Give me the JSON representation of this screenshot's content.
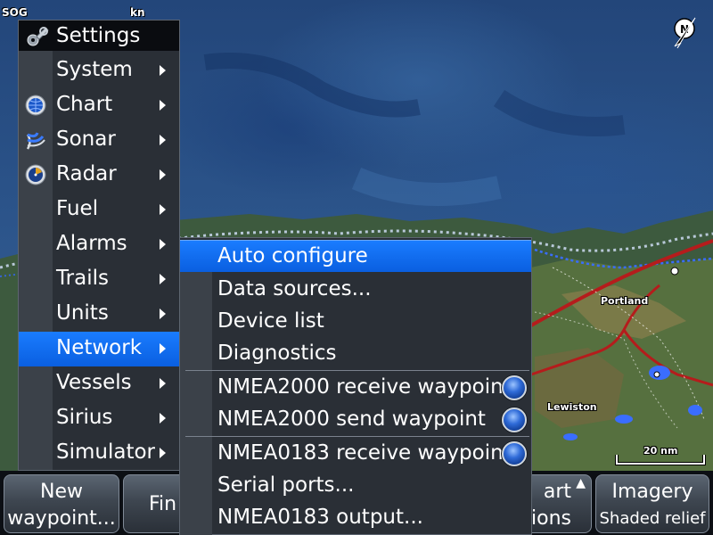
{
  "status": {
    "sog_label": "SOG",
    "sog_unit": "kn"
  },
  "map": {
    "city_1": "Portland",
    "city_2": "Lewiston",
    "scale": "20 nm",
    "north": "N"
  },
  "settings_menu": {
    "title": "Settings",
    "items": [
      {
        "label": "System",
        "icon": "none"
      },
      {
        "label": "Chart",
        "icon": "globe-icon"
      },
      {
        "label": "Sonar",
        "icon": "sonar-icon"
      },
      {
        "label": "Radar",
        "icon": "radar-icon"
      },
      {
        "label": "Fuel",
        "icon": "none"
      },
      {
        "label": "Alarms",
        "icon": "none"
      },
      {
        "label": "Trails",
        "icon": "none"
      },
      {
        "label": "Units",
        "icon": "none"
      },
      {
        "label": "Network",
        "icon": "none",
        "selected": true
      },
      {
        "label": "Vessels",
        "icon": "none"
      },
      {
        "label": "Sirius",
        "icon": "none"
      },
      {
        "label": "Simulator",
        "icon": "none"
      }
    ]
  },
  "network_menu": {
    "items": [
      {
        "label": "Auto configure",
        "selected": true
      },
      {
        "label": "Data sources..."
      },
      {
        "label": "Device list"
      },
      {
        "label": "Diagnostics"
      },
      {
        "label": "NMEA2000 receive waypoint",
        "toggle": true
      },
      {
        "label": "NMEA2000 send waypoint",
        "toggle": true
      },
      {
        "label": "NMEA0183 receive waypoint",
        "toggle": true
      },
      {
        "label": "Serial ports..."
      },
      {
        "label": "NMEA0183 output..."
      }
    ]
  },
  "softkeys": {
    "new_line1": "New",
    "new_line2": "waypoint...",
    "find": "Fin",
    "chart_line1": "art",
    "chart_line2": "ions",
    "imagery_line1": "Imagery",
    "imagery_line2": "Shaded relief"
  },
  "colors": {
    "accent": "#0a6cf0",
    "menu_bg": "#2a2f36",
    "header_bg": "#0a0c10"
  }
}
